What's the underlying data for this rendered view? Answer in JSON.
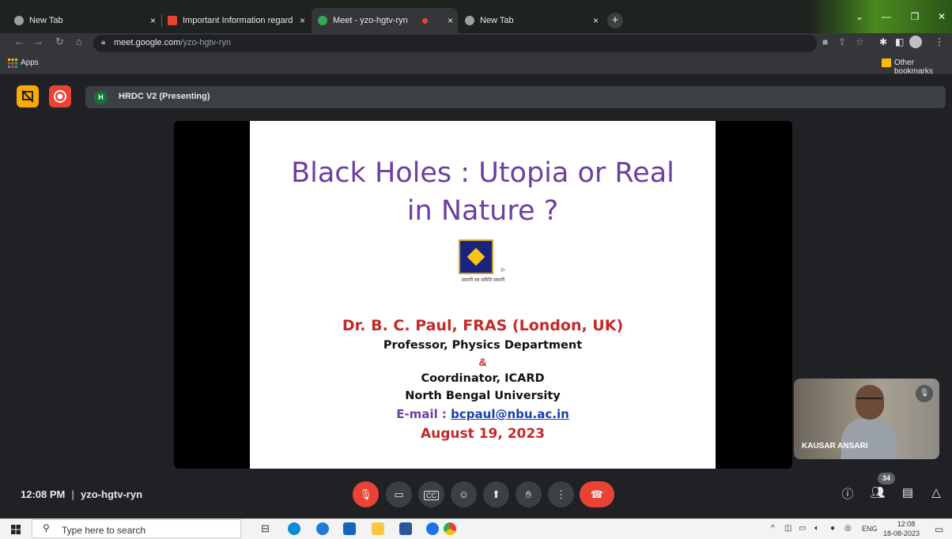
{
  "browser": {
    "tabs": [
      {
        "title": "New Tab",
        "active": false
      },
      {
        "title": "Important Information regarding",
        "active": false
      },
      {
        "title": "Meet - yzo-hgtv-ryn",
        "active": true
      },
      {
        "title": "New Tab",
        "active": false
      }
    ],
    "close_glyph": "×",
    "new_tab_glyph": "+",
    "url_host": "meet.google.com",
    "url_path": "/yzo-hgtv-ryn",
    "bookmarks": {
      "apps_label": "Apps",
      "other_label": "Other bookmarks"
    }
  },
  "meet": {
    "presenter_initial": "H",
    "presenting_label": "HRDC V2 (Presenting)",
    "slide": {
      "title_line1": "Black Holes : Utopia or Real",
      "title_line2": "in Nature ?",
      "logo_motto": "समानी वय समिति समानी",
      "author": "Dr. B. C. Paul, FRAS (London, UK)",
      "line1": "Professor, Physics Department",
      "amp": "&",
      "line2": "Coordinator, ICARD",
      "line3": "North Bengal University",
      "email_prefix": "E-mail : ",
      "email": "bcpaul@nbu.ac.in",
      "date": "August 19, 2023"
    },
    "participant_name": "KAUSAR ANSARI",
    "meeting_time": "12:08 PM",
    "meeting_code": "yzo-hgtv-ryn",
    "people_count": "34"
  },
  "taskbar": {
    "search_placeholder": "Type here to search",
    "language": "ENG",
    "time": "12:08",
    "date": "18-08-2023"
  },
  "colors": {
    "meet_red": "#ea4335",
    "meet_yellow": "#f9ab00",
    "slide_title_purple": "#6c3fa0",
    "slide_red": "#c62828"
  }
}
